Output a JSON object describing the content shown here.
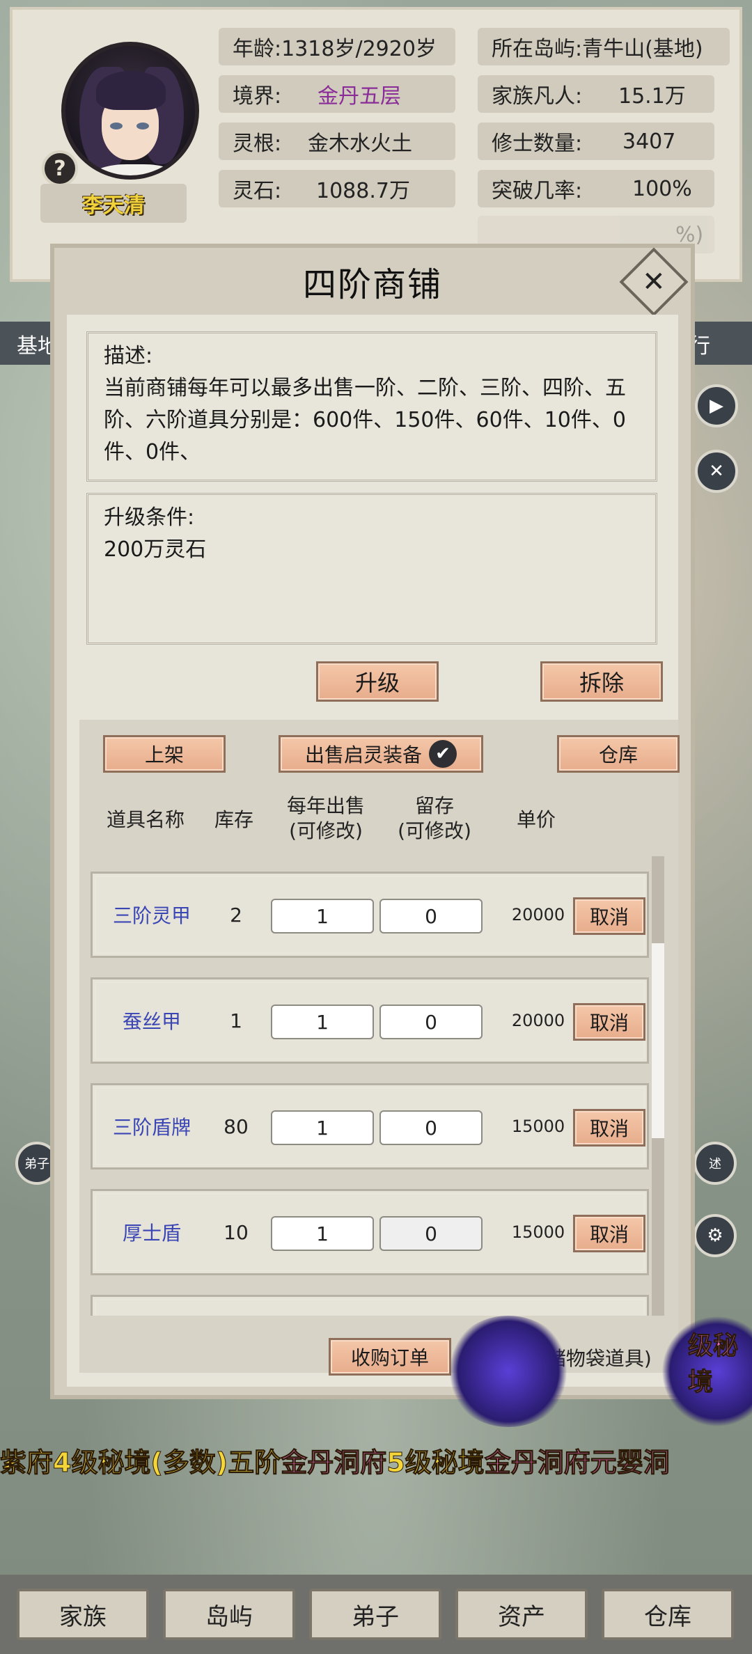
{
  "profile": {
    "name": "李天清",
    "stats_left": [
      {
        "label": "年龄:",
        "value": "1318岁/2920岁"
      },
      {
        "label": "境界:",
        "value": "金丹五层"
      },
      {
        "label": "灵根:",
        "value": "金木水火土"
      },
      {
        "label": "灵石:",
        "value": "1088.7万"
      }
    ],
    "stats_right": [
      {
        "label": "所在岛屿:",
        "value": "青牛山(基地)"
      },
      {
        "label": "家族凡人:",
        "value": "15.1万"
      },
      {
        "label": "修士数量:",
        "value": "3407"
      },
      {
        "label": "突破几率:",
        "value": "100%"
      }
    ],
    "partial_row_right": "%)"
  },
  "side_tabs": {
    "left": "基地",
    "right": "行"
  },
  "dialog": {
    "title": "四阶商铺",
    "description_title": "描述:",
    "description_text": "当前商铺每年可以最多出售一阶、二阶、三阶、四阶、五阶、六阶道具分别是：600件、150件、60件、10件、0件、0件、",
    "upgrade_title": "升级条件:",
    "upgrade_text": "200万灵石",
    "upgrade_button": "升级",
    "demolish_button": "拆除",
    "list_button": "上架",
    "sell_toggle": "出售启灵装备",
    "warehouse_button": "仓库",
    "headers": {
      "name": "道具名称",
      "stock": "库存",
      "per_year_1": "每年出售",
      "per_year_2": "(可修改)",
      "reserve_1": "留存",
      "reserve_2": "(可修改)",
      "price": "单价"
    },
    "items": [
      {
        "name": "三阶灵甲",
        "stock": "2",
        "per_year": "1",
        "reserve": "0",
        "price": "20000",
        "action": "取消"
      },
      {
        "name": "蚕丝甲",
        "stock": "1",
        "per_year": "1",
        "reserve": "0",
        "price": "20000",
        "action": "取消"
      },
      {
        "name": "三阶盾牌",
        "stock": "80",
        "per_year": "1",
        "reserve": "0",
        "price": "15000",
        "action": "取消"
      },
      {
        "name": "厚士盾",
        "stock": "10",
        "per_year": "1",
        "reserve": "0",
        "price": "15000",
        "action": "取消"
      }
    ],
    "purchase_button": "收购订单",
    "purchase_note": "(收购弟子储物袋道具)"
  },
  "marquee": {
    "part1": "紫府",
    "part2": "4级秘境(多数)五阶",
    "part3": "金丹洞府",
    "part4": "5级秘境",
    "part5": "金丹洞府",
    "part6": "元婴洞",
    "right_fragment": "级秘境"
  },
  "side_labels": {
    "left": "弟子",
    "right": "述"
  },
  "nav": [
    "家族",
    "岛屿",
    "弟子",
    "资产",
    "仓库"
  ],
  "colors": {
    "realm": "#8a2c97",
    "item_name": "#3b46b5",
    "button": "#e7ad8c",
    "name_plate_text": "#f2d23a"
  }
}
